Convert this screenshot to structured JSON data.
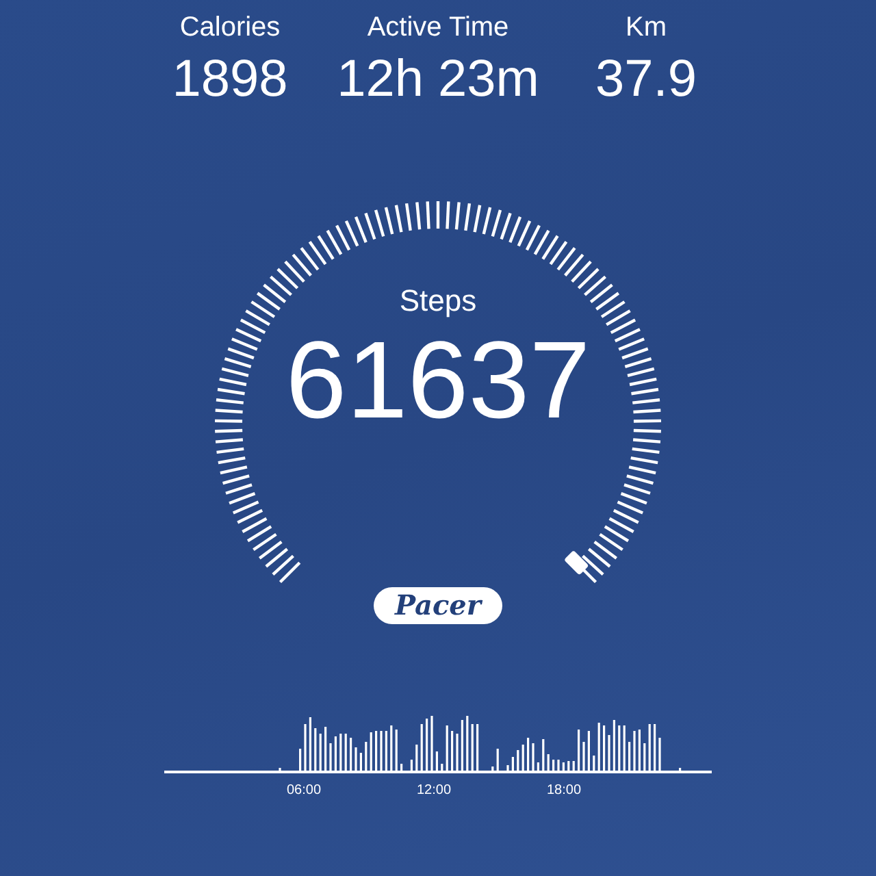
{
  "stats": [
    {
      "label": "Calories",
      "value": "1898"
    },
    {
      "label": "Active Time",
      "value": "12h 23m"
    },
    {
      "label": "Km",
      "value": "37.9"
    }
  ],
  "gauge": {
    "label": "Steps",
    "value": "61637"
  },
  "logo": {
    "text": "Pacer"
  },
  "activity_chart": {
    "time_labels": [
      "06:00",
      "12:00",
      "18:00"
    ]
  }
}
